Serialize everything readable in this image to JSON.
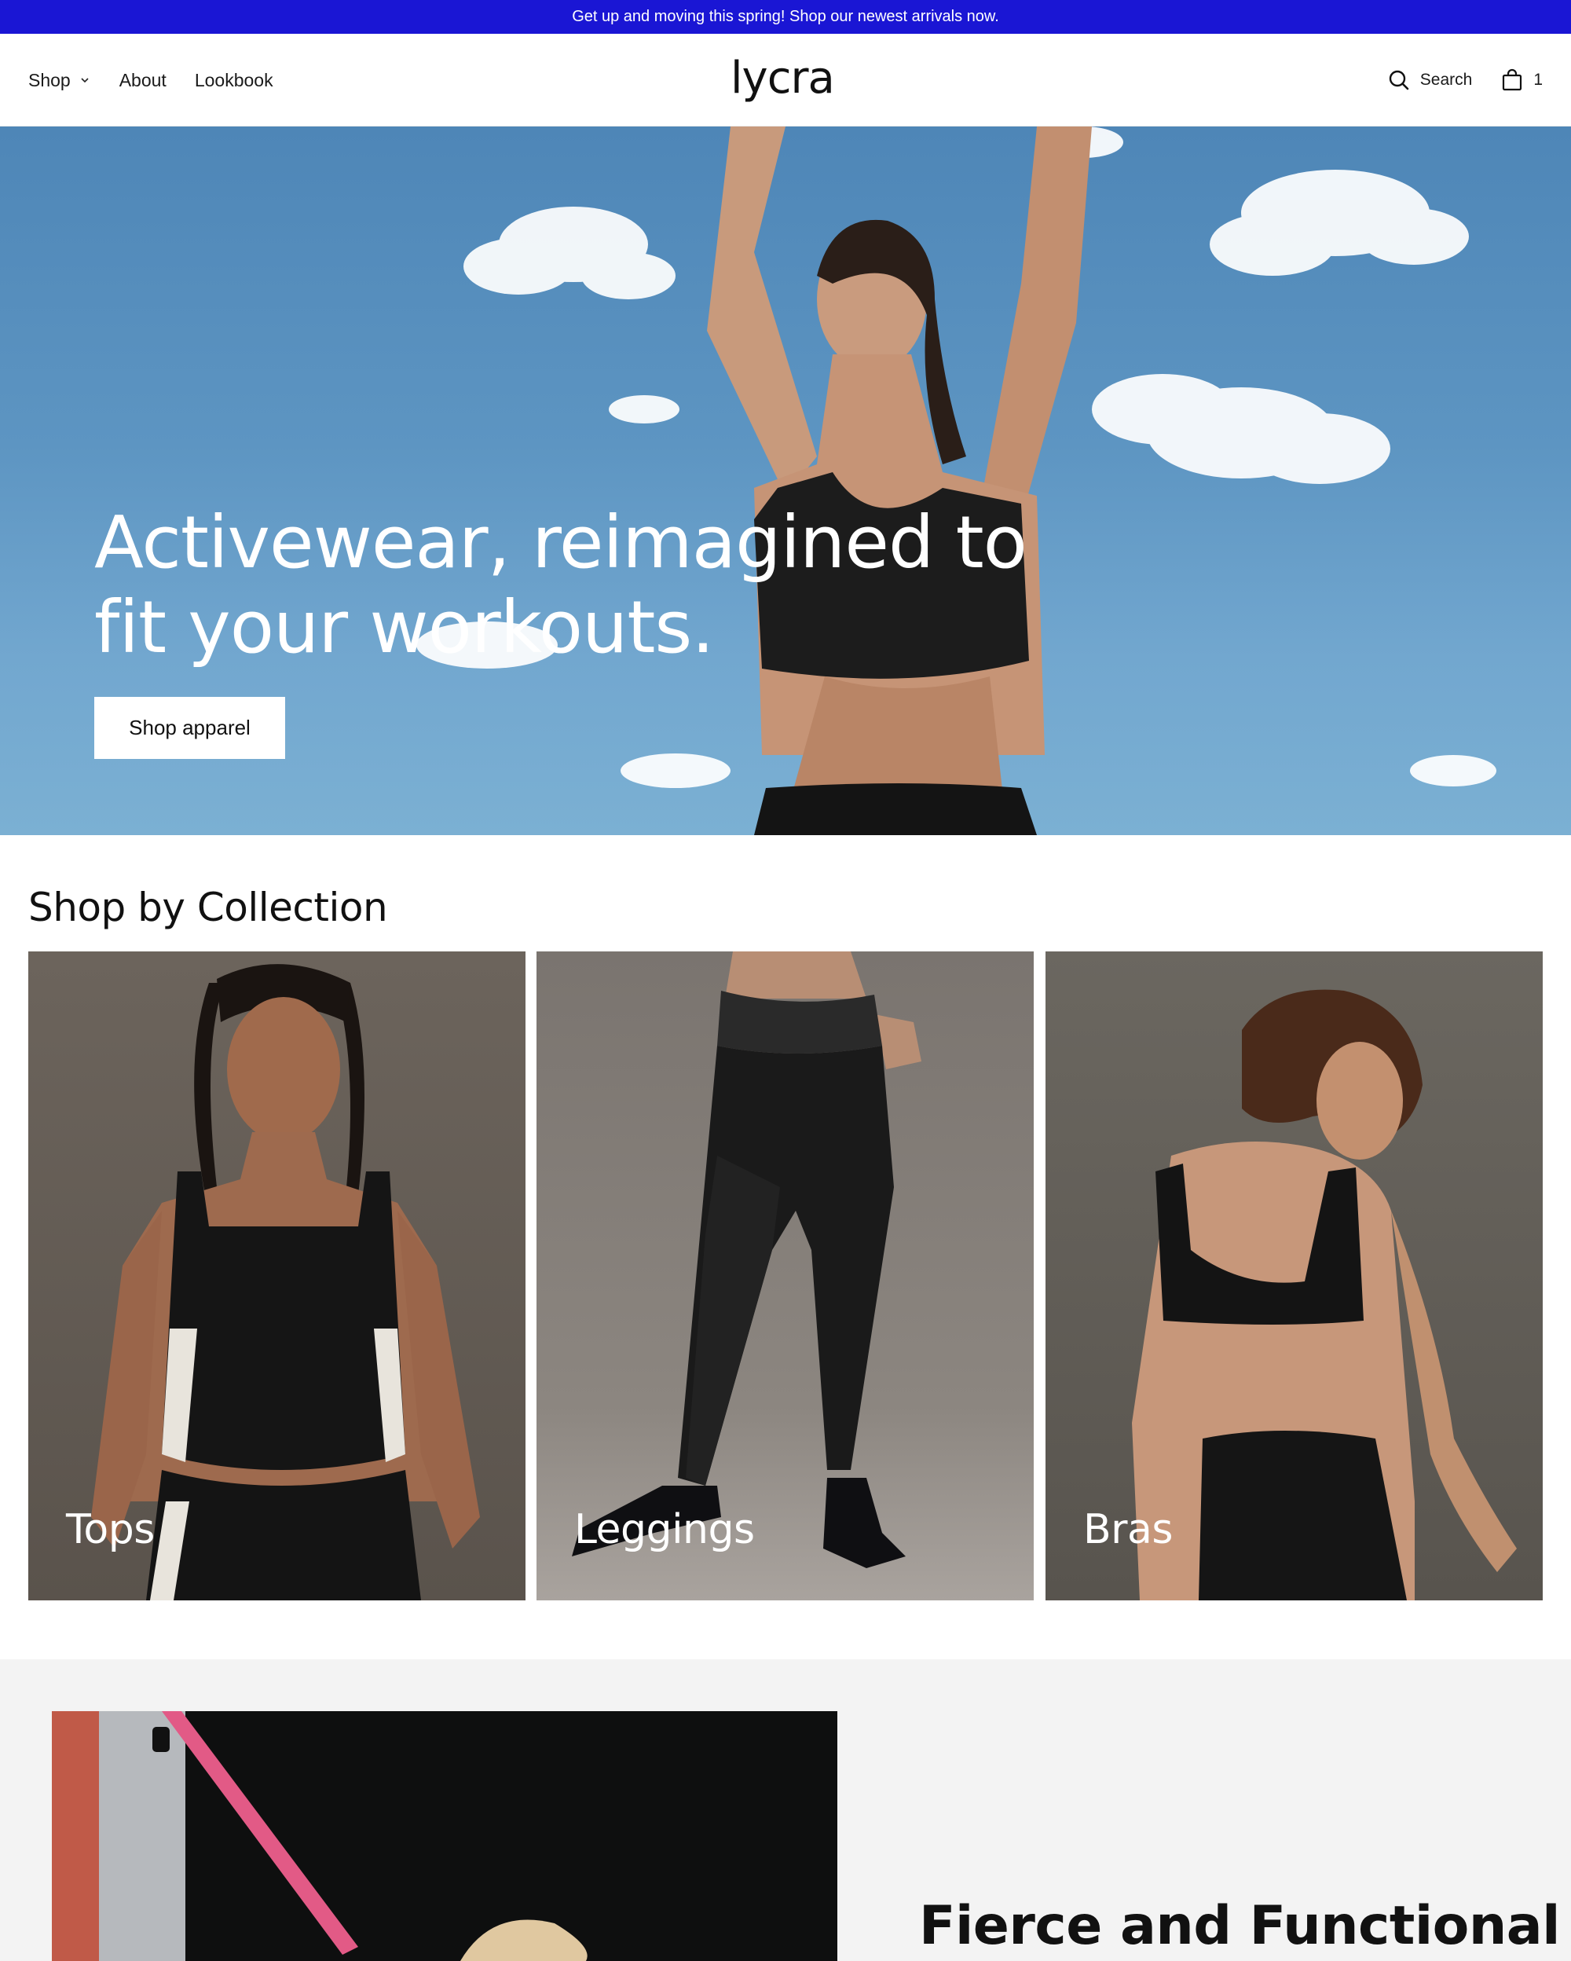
{
  "announcement": {
    "text": "Get up and moving this spring! Shop our newest arrivals now."
  },
  "header": {
    "nav": [
      {
        "label": "Shop",
        "has_dropdown": true
      },
      {
        "label": "About"
      },
      {
        "label": "Lookbook"
      }
    ],
    "logo": "lycra",
    "search_label": "Search",
    "cart_count": "1"
  },
  "hero": {
    "title_line1": "Activewear, reimagined to",
    "title_line2": "fit your workouts.",
    "button_label": "Shop apparel"
  },
  "collections": {
    "title": "Shop by Collection",
    "items": [
      {
        "label": "Tops"
      },
      {
        "label": "Leggings"
      },
      {
        "label": "Bras"
      }
    ]
  },
  "feature": {
    "title": "Fierce and Functional"
  },
  "colors": {
    "announcement_bg": "#1a16d4",
    "hero_sky": "#5d95c2",
    "feature_bg": "#f3f3f3"
  }
}
